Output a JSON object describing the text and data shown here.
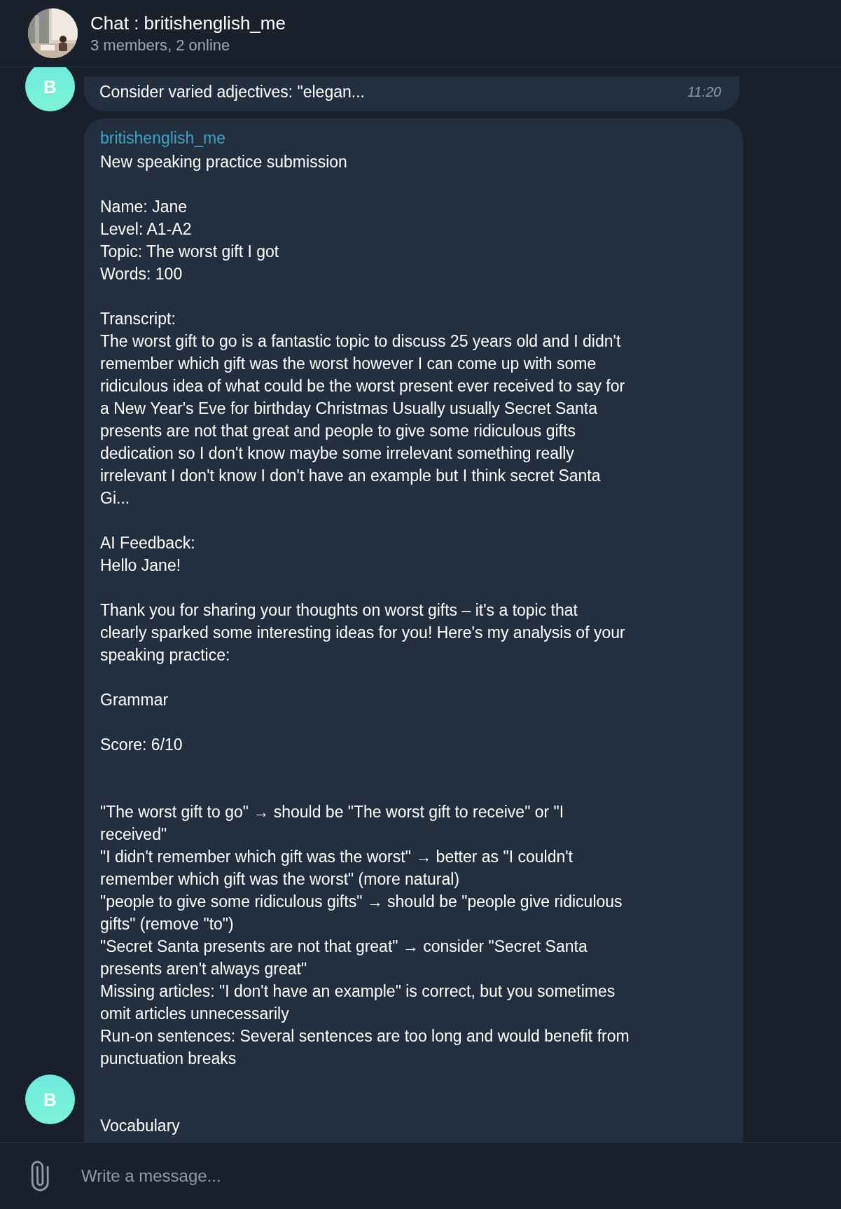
{
  "header": {
    "title": "Chat : britishenglish_me",
    "subtitle": "3 members, 2 online"
  },
  "messages": [
    {
      "avatar": "B",
      "blocks": [
        {
          "kind": "text",
          "lines": [
            "Consider varied adjectives: \"elegan..."
          ]
        }
      ],
      "time": "11:20"
    },
    {
      "avatar": "B",
      "sender": "britishenglish_me",
      "blocks": [
        {
          "kind": "text",
          "lines": [
            "New speaking practice submission"
          ]
        },
        {
          "kind": "text",
          "lines": [
            "Name: Jane",
            "Level: A1-A2",
            "Topic: The worst gift I got",
            "Words: 100"
          ]
        },
        {
          "kind": "text",
          "lines": [
            "Transcript:",
            "The worst gift to go is a fantastic topic to discuss 25 years old and I didn't",
            "remember which gift was the worst however I can come up with some",
            "ridiculous idea of what could be the worst present ever received to say for",
            "a New Year's Eve for birthday Christmas Usually usually Secret Santa",
            "presents are not that great and people to give some ridiculous gifts",
            "dedication so I don't know maybe some irrelevant something really",
            "irrelevant I don't know I don't have an example but I think secret Santa",
            "Gi..."
          ]
        },
        {
          "kind": "text",
          "lines": [
            "AI Feedback:",
            "Hello Jane!"
          ]
        },
        {
          "kind": "text",
          "lines": [
            "Thank you for sharing your thoughts on worst gifts – it's a topic that",
            "clearly sparked some interesting ideas for you! Here's my analysis of your",
            "speaking practice:"
          ]
        },
        {
          "kind": "text",
          "lines": [
            "Grammar"
          ]
        },
        {
          "kind": "text",
          "lines": [
            "Score: 6/10"
          ]
        },
        {
          "kind": "spaced",
          "lines": [
            "\"The worst gift to go\" → should be \"The worst gift to receive\" or \"I",
            "received\"",
            "\"I didn't remember which gift was the worst\" → better as \"I couldn't",
            "remember which gift was the worst\" (more natural)",
            "\"people to give some ridiculous gifts\" → should be \"people give ridiculous",
            "gifts\" (remove \"to\")",
            "\"Secret Santa presents are not that great\" → consider \"Secret Santa",
            "presents aren't always great\"",
            "Missing articles: \"I don't have an example\" is correct, but you sometimes",
            "omit articles unnecessarily",
            "Run-on sentences: Several sentences are too long and would benefit from",
            "punctuation breaks"
          ]
        },
        {
          "kind": "spaced",
          "lines": [
            "Vocabulary"
          ]
        }
      ]
    }
  ],
  "composer": {
    "placeholder": "Write a message..."
  }
}
